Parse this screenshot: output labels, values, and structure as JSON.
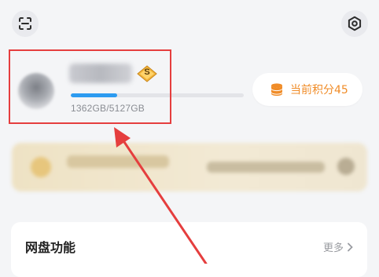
{
  "topbar": {
    "scan_icon": "scan-icon",
    "settings_icon": "settings-icon"
  },
  "profile": {
    "vip_badge_letter": "S",
    "storage_text": "1362GB/5127GB",
    "storage_used_fraction": 0.266
  },
  "points": {
    "label": "当前积分45",
    "icon": "coins-icon"
  },
  "feature_card": {
    "title": "网盘功能",
    "more_label": "更多"
  },
  "colors": {
    "accent_blue": "#2d9bf0",
    "points_orange": "#f08c28",
    "highlight_red": "#e53e3e"
  }
}
